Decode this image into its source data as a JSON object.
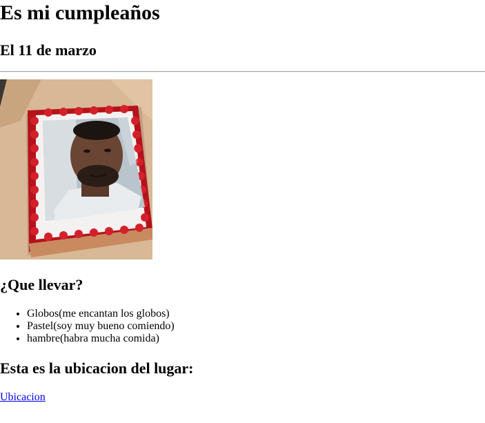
{
  "page": {
    "title": "Es mi cumpleaños",
    "date": "El 11 de marzo"
  },
  "image": {
    "alt": "pastel de cumpleaños con foto"
  },
  "bring": {
    "heading": "¿Que llevar?",
    "items": [
      "Globos(me encantan los globos)",
      "Pastel(soy muy bueno comiendo)",
      "hambre(habra mucha comida)"
    ]
  },
  "location": {
    "heading": "Esta es la ubicacion del lugar:",
    "link_label": "Ubicacion"
  },
  "colors": {
    "link": "#0000ee",
    "frosting": "#b5121b",
    "box": "#d9b48f"
  }
}
